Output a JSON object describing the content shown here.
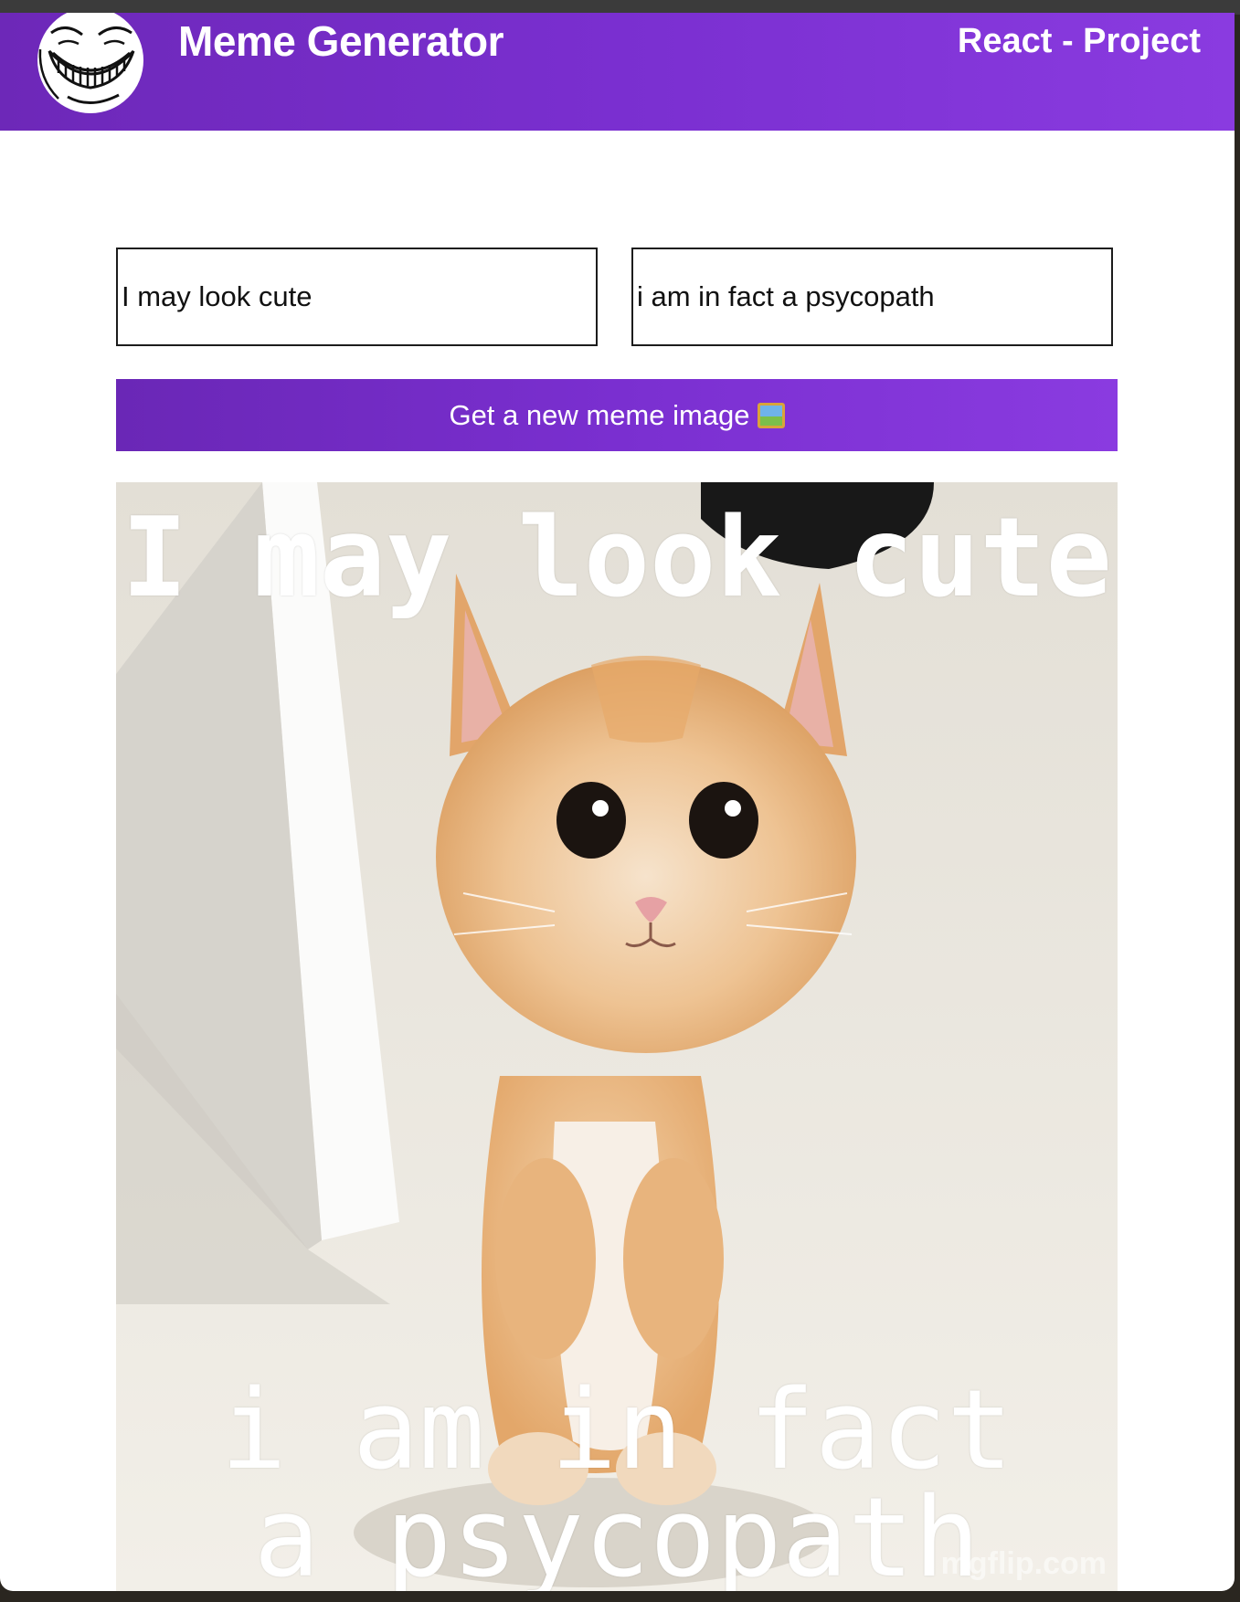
{
  "header": {
    "app_title": "Meme Generator",
    "project_label": "React - Project",
    "logo_icon": "troll-face-icon"
  },
  "form": {
    "top_text_value": "I may look cute",
    "bottom_text_value": "i am in fact a psycopath",
    "button_label": "Get a new meme image",
    "button_icon": "picture-icon"
  },
  "meme": {
    "image_subject": "kitten-photo",
    "top_text": "I may look cute",
    "bottom_text": "i am in fact a psycopath",
    "watermark": "mgflip.com"
  },
  "colors": {
    "accent_start": "#6a27b6",
    "accent_end": "#8a3be0",
    "meme_text": "#ffffff"
  }
}
